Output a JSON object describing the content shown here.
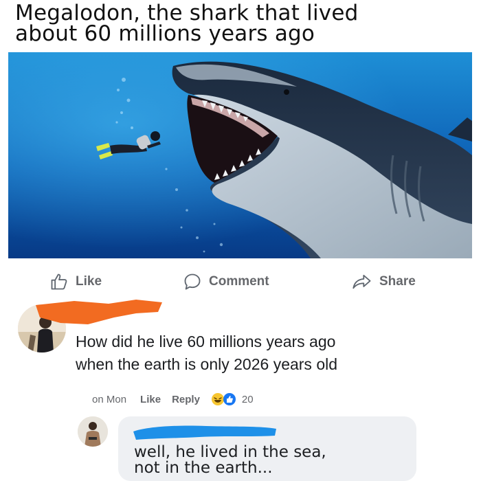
{
  "post": {
    "title_line1": "Megalodon, the shark that lived",
    "title_line2": "about 60 millions years ago",
    "image": "megalodon-and-diver-underwater"
  },
  "actions": {
    "like_label": "Like",
    "comment_label": "Comment",
    "share_label": "Share",
    "icons": [
      "thumbs-up-icon",
      "comment-icon",
      "share-icon"
    ],
    "text_color": "#65676b"
  },
  "comment": {
    "name_redacted": true,
    "redaction_color": "#f26b21",
    "text_line1": "How did he live 60 millions years ago",
    "text_line2": "when the earth is only 2026 years old",
    "time": "on Mon",
    "like_label": "Like",
    "reply_label": "Reply",
    "reactions": [
      "haha",
      "like"
    ],
    "reaction_count": "20"
  },
  "reply": {
    "name_redacted": true,
    "redaction_color": "#1e90e8",
    "text_line1": "well, he lived in the sea,",
    "text_line2": "not in the earth...",
    "bubble_color": "#eef0f3"
  }
}
